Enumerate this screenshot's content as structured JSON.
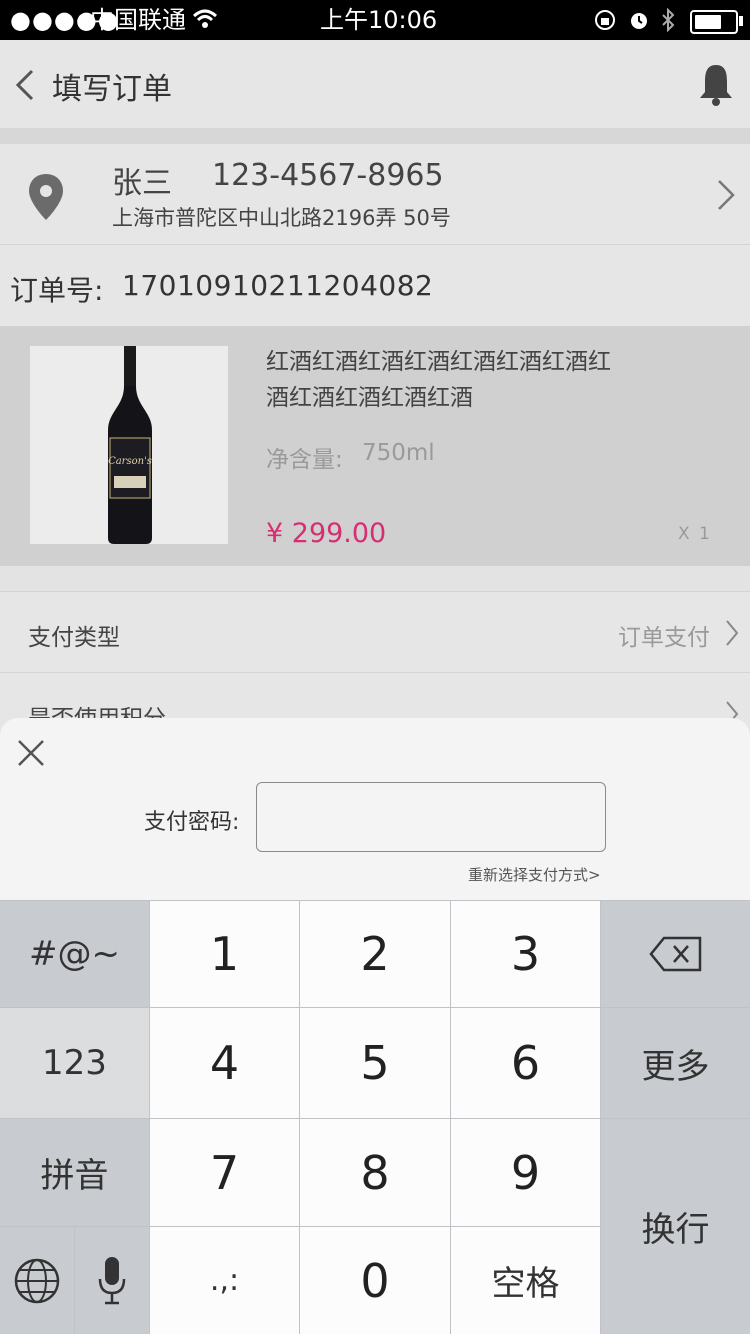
{
  "status_bar": {
    "carrier": "中国联通",
    "time": "上午10:06"
  },
  "nav": {
    "title": "填写订单"
  },
  "address": {
    "name": "张三",
    "phone": "123-4567-8965",
    "detail": "上海市普陀区中山北路2196弄 50号"
  },
  "order": {
    "label": "订单号:",
    "number": "17010910211204082"
  },
  "product": {
    "name_line1": "红酒红酒红酒红酒红酒红酒红酒红",
    "name_line2": "酒红酒红酒红酒红酒",
    "spec_label": "净含量:",
    "spec_value": "750ml",
    "price": "¥ 299.00",
    "quantity": "X 1",
    "bottle_label": "Carson's"
  },
  "payment_type": {
    "label": "支付类型",
    "value": "订单支付"
  },
  "points": {
    "label": "是否使用积分"
  },
  "sheet": {
    "password_label": "支付密码:",
    "reselect": "重新选择支付方式>"
  },
  "keyboard": {
    "symbols": "#@~",
    "k1": "1",
    "k2": "2",
    "k3": "3",
    "more123": "123",
    "k4": "4",
    "k5": "5",
    "k6": "6",
    "more": "更多",
    "pinyin": "拼音",
    "k7": "7",
    "k8": "8",
    "k9": "9",
    "enter": "换行",
    "punct": ".,:",
    "k0": "0",
    "space": "空格"
  },
  "colors": {
    "price": "#d62e73",
    "status_bg": "#000000",
    "page_bg": "#e6e6e6"
  }
}
